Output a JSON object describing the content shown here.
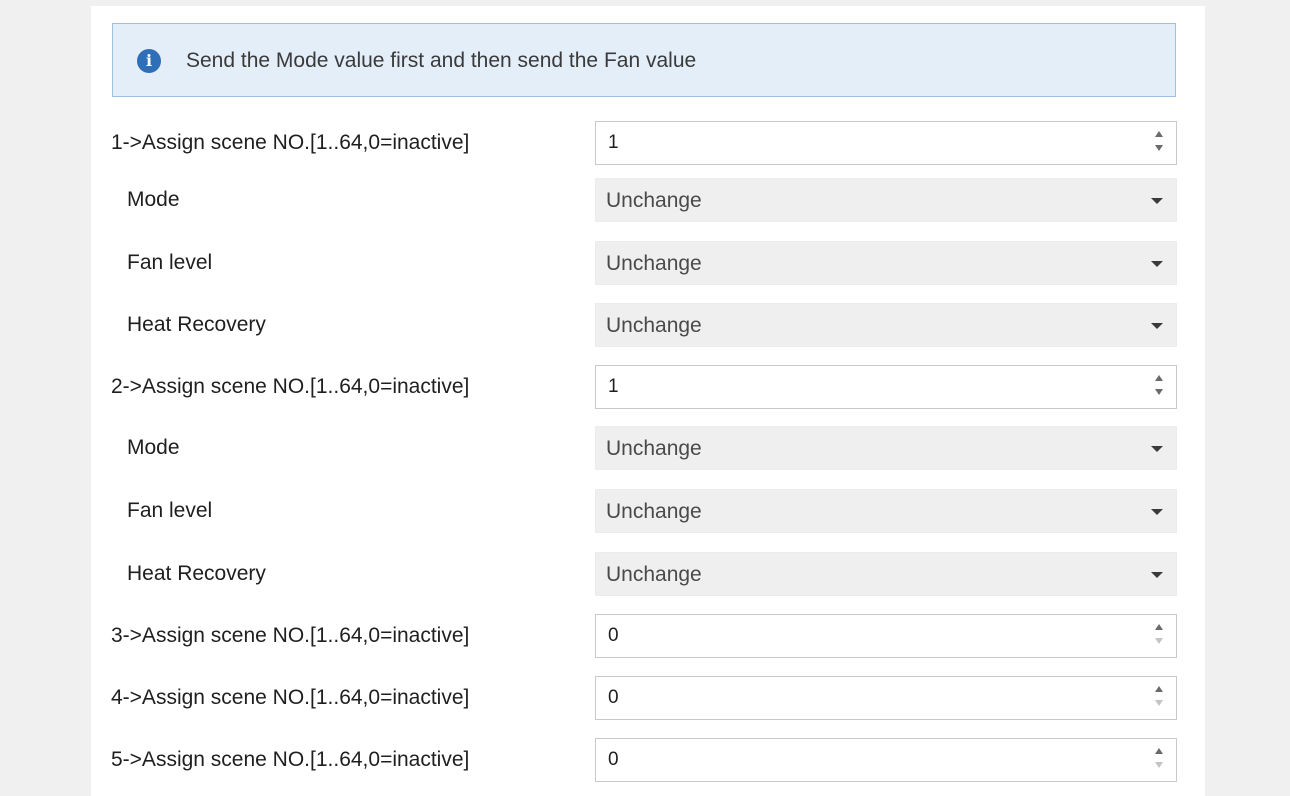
{
  "info": {
    "icon": "info-icon",
    "icon_glyph": "i",
    "text": "Send the Mode value first and then send the Fan value"
  },
  "scenes": [
    {
      "label": "1->Assign scene NO.[1..64,0=inactive]",
      "value": "1",
      "mode_label": "Mode",
      "mode_value": "Unchange",
      "fan_label": "Fan level",
      "fan_value": "Unchange",
      "heat_label": "Heat Recovery",
      "heat_value": "Unchange"
    },
    {
      "label": "2->Assign scene NO.[1..64,0=inactive]",
      "value": "1",
      "mode_label": "Mode",
      "mode_value": "Unchange",
      "fan_label": "Fan level",
      "fan_value": "Unchange",
      "heat_label": "Heat Recovery",
      "heat_value": "Unchange"
    },
    {
      "label": "3->Assign scene NO.[1..64,0=inactive]",
      "value": "0"
    },
    {
      "label": "4->Assign scene NO.[1..64,0=inactive]",
      "value": "0"
    },
    {
      "label": "5->Assign scene NO.[1..64,0=inactive]",
      "value": "0"
    }
  ]
}
